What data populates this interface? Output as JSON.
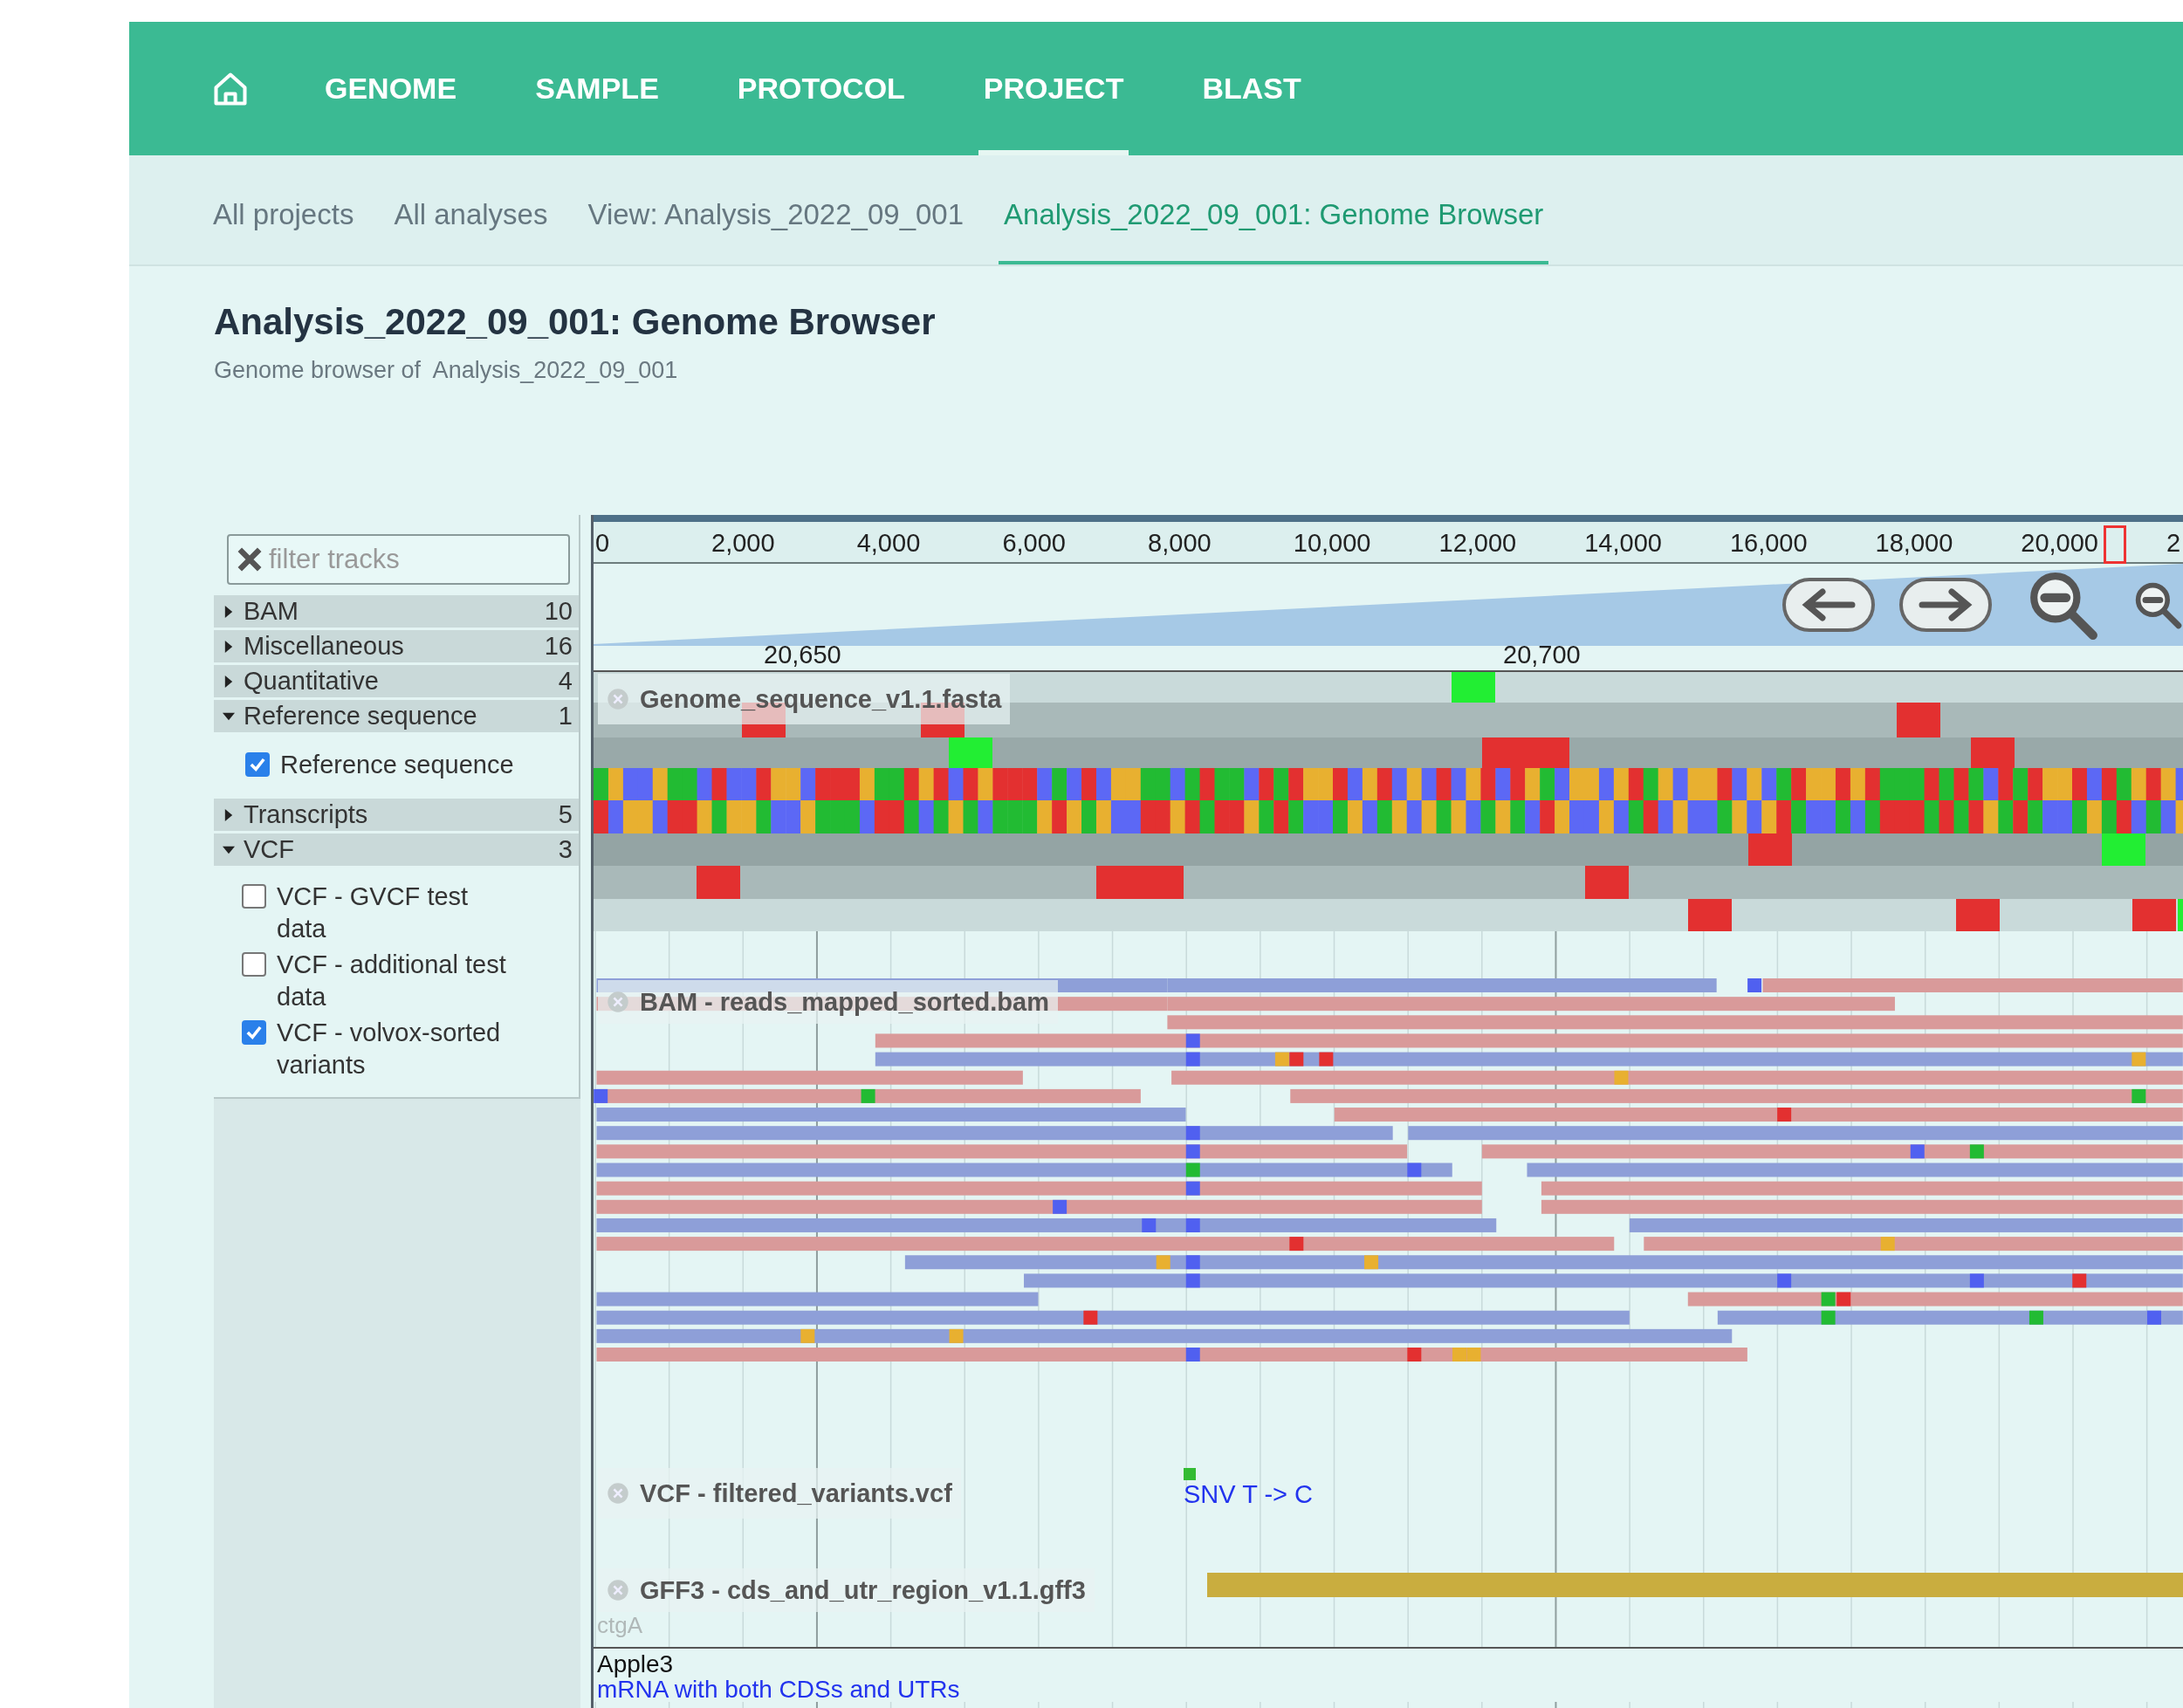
{
  "nav": {
    "items": [
      {
        "label": "GENOME",
        "selected": false
      },
      {
        "label": "SAMPLE",
        "selected": false
      },
      {
        "label": "PROTOCOL",
        "selected": false
      },
      {
        "label": "PROJECT",
        "selected": true
      },
      {
        "label": "BLAST",
        "selected": false
      }
    ]
  },
  "breadcrumbs": [
    {
      "label": "All projects",
      "selected": false
    },
    {
      "label": "All analyses",
      "selected": false
    },
    {
      "label": "View: Analysis_2022_09_001",
      "selected": false
    },
    {
      "label": "Analysis_2022_09_001: Genome Browser",
      "selected": true
    }
  ],
  "page": {
    "title": "Analysis_2022_09_001: Genome Browser",
    "subtitle": "Genome browser of  Analysis_2022_09_001"
  },
  "track_selector": {
    "filter": {
      "placeholder": "filter tracks"
    },
    "categories": [
      {
        "label": "BAM",
        "count": "10",
        "expanded": false
      },
      {
        "label": "Miscellaneous",
        "count": "16",
        "expanded": false
      },
      {
        "label": "Quantitative",
        "count": "4",
        "expanded": false
      },
      {
        "label": "Reference sequence",
        "count": "1",
        "expanded": true,
        "tracks": [
          {
            "label": "Reference sequence",
            "checked": true
          }
        ]
      },
      {
        "label": "Transcripts",
        "count": "5",
        "expanded": false
      },
      {
        "label": "VCF",
        "count": "3",
        "expanded": true,
        "tracks": [
          {
            "label": "VCF - GVCF test data",
            "checked": false
          },
          {
            "label": "VCF - additional test data",
            "checked": false
          },
          {
            "label": "VCF - volvox-sorted variants",
            "checked": true
          }
        ]
      }
    ]
  },
  "ruler": {
    "labels": [
      "0",
      "2,000",
      "4,000",
      "6,000",
      "8,000",
      "10,000",
      "12,000",
      "14,000",
      "16,000",
      "18,000",
      "20,000",
      "2"
    ]
  },
  "scale": {
    "labels": [
      "20,650",
      "20,700"
    ]
  },
  "tracks": [
    {
      "kind": "sequence",
      "label": "Genome_sequence_v1.1.fasta"
    },
    {
      "kind": "alignments",
      "label": "BAM - reads_mapped_sorted.bam"
    },
    {
      "kind": "variants",
      "label": "VCF - filtered_variants.vcf",
      "features": [
        {
          "label": "SNV T -> C"
        }
      ]
    },
    {
      "kind": "features",
      "label": "GFF3 - cds_and_utr_region_v1.1.gff3",
      "reference": "ctgA"
    }
  ],
  "feature_details": {
    "name": "Apple3",
    "description": "mRNA with both CDSs and UTRs"
  }
}
